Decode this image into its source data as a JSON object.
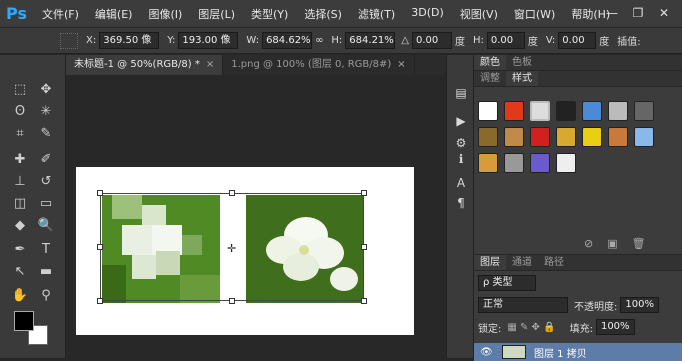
{
  "app": {
    "logo": "Ps"
  },
  "menu": [
    "文件(F)",
    "编辑(E)",
    "图像(I)",
    "图层(L)",
    "类型(Y)",
    "选择(S)",
    "滤镜(T)",
    "3D(D)",
    "视图(V)",
    "窗口(W)",
    "帮助(H)"
  ],
  "window_buttons": {
    "minimize": "—",
    "restore": "❐",
    "close": "✕"
  },
  "options": {
    "x_label": "X:",
    "x_value": "369.50 像",
    "y_label": "Y:",
    "y_value": "193.00 像",
    "w_label": "W:",
    "w_value": "684.62%",
    "link_icon": "∞",
    "h_label": "H:",
    "h_value": "684.21%",
    "angle_value": "0.00",
    "angle_unit": "度",
    "hskew_label": "H:",
    "hskew_value": "0.00",
    "hskew_unit": "度",
    "vskew_label": "V:",
    "vskew_value": "0.00",
    "vskew_unit": "度",
    "interp_label": "插值:"
  },
  "tabs": [
    {
      "label": "未标题-1 @ 50%(RGB/8) *",
      "close": "×"
    },
    {
      "label": "1.png @ 100% (图层 0, RGB/8#)",
      "close": "×"
    }
  ],
  "panels": {
    "top_tabs": [
      "颜色",
      "色板"
    ],
    "style_tabs": [
      "调整",
      "样式"
    ],
    "layers_tabs": [
      "图层",
      "通道",
      "路径"
    ],
    "kind_filter": "ρ 类型",
    "blend_mode": "正常",
    "opacity_label": "不透明度:",
    "opacity_value": "100%",
    "lock_label": "锁定:",
    "fill_label": "填充:",
    "fill_value": "100%",
    "layer_name": "图层 1 拷贝"
  },
  "colors": {
    "accent": "#31a8ff",
    "selected_layer": "#5d7ca8"
  }
}
